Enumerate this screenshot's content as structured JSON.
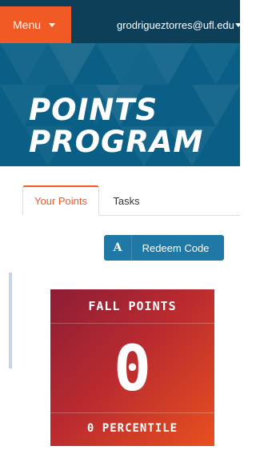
{
  "header": {
    "menu_label": "Menu",
    "user_email": "grodrigueztorres@ufl.edu"
  },
  "banner": {
    "title_line1": "POINTS",
    "title_line2": "PROGRAM"
  },
  "tabs": [
    {
      "label": "Your Points",
      "active": true
    },
    {
      "label": "Tasks",
      "active": false
    }
  ],
  "redeem": {
    "icon_letter": "A",
    "label": "Redeem Code"
  },
  "points_card": {
    "title": "FALL POINTS",
    "value": "0",
    "percentile": "0 PERCENTILE"
  },
  "colors": {
    "accent": "#f15a24",
    "header_bg": "#0e3f59",
    "banner_bg": "#0a5f86",
    "button_bg": "#1f78a5"
  }
}
